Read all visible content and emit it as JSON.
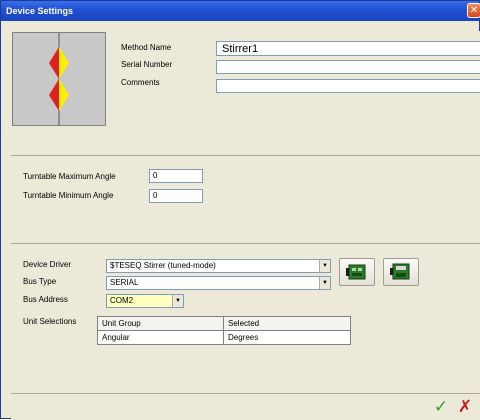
{
  "window": {
    "title": "Device Settings",
    "close_glyph": "✕"
  },
  "method": {
    "name_label": "Method Name",
    "name_value": "Stirrer1",
    "serial_label": "Serial Number",
    "serial_value": "",
    "comments_label": "Comments",
    "comments_value": "",
    "icon": "stirrer-device-icon"
  },
  "turntable": {
    "max_label": "Turntable Maximum Angle",
    "max_value": "0",
    "min_label": "Turntable Minimum Angle",
    "min_value": "0"
  },
  "device": {
    "driver_label": "Device Driver",
    "driver_value": "$TESEQ Stirrer (tuned-mode)",
    "bus_type_label": "Bus Type",
    "bus_type_value": "SERIAL",
    "bus_address_label": "Bus Address",
    "bus_address_value": "COM2",
    "unit_selections_label": "Unit Selections",
    "units_table": {
      "headers": [
        "Unit Group",
        "Selected"
      ],
      "rows": [
        [
          "Angular",
          "Degrees"
        ]
      ]
    },
    "icon_buttons": [
      "device-config-icon",
      "device-save-icon"
    ]
  },
  "footer": {
    "ok_glyph": "✓",
    "cancel_glyph": "✗"
  },
  "colors": {
    "titlebar": "#1f4fd0",
    "highlight_field": "#ffffc0",
    "ok": "#2aa02a",
    "cancel": "#c81818"
  }
}
